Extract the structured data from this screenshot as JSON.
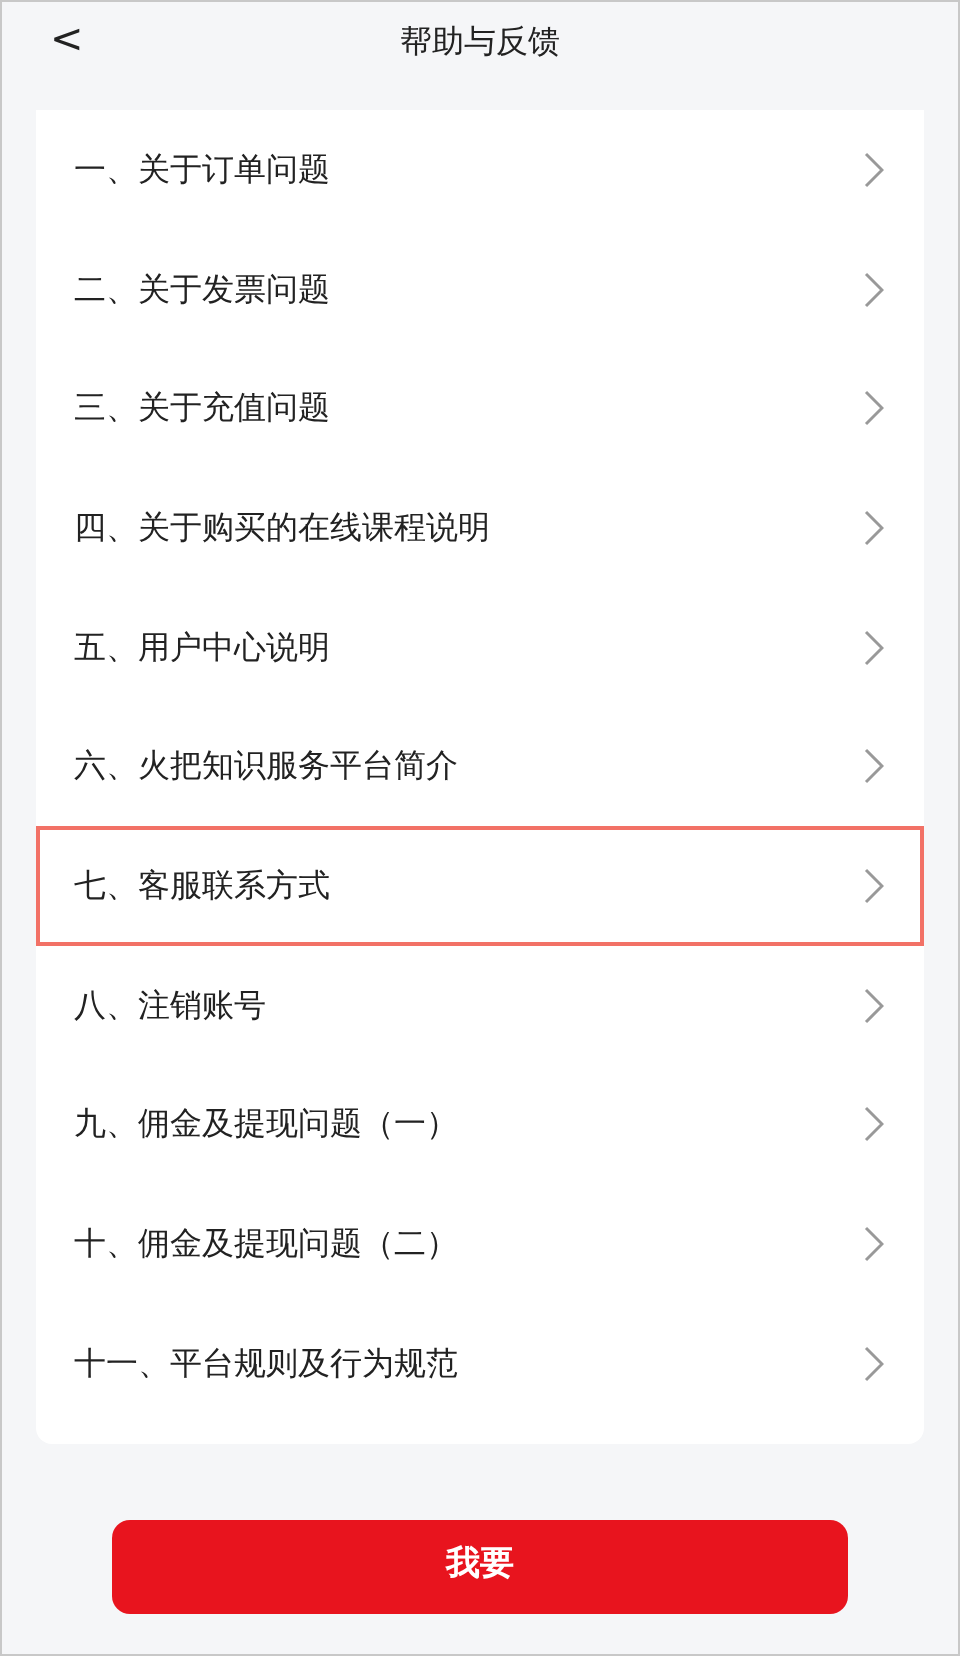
{
  "header": {
    "back": "<",
    "title": "帮助与反馈"
  },
  "items": [
    {
      "label": "一、关于订单问题",
      "selected": false
    },
    {
      "label": "二、关于发票问题",
      "selected": false
    },
    {
      "label": "三、关于充值问题",
      "selected": false
    },
    {
      "label": "四、关于购买的在线课程说明",
      "selected": false
    },
    {
      "label": "五、用户中心说明",
      "selected": false
    },
    {
      "label": "六、火把知识服务平台简介",
      "selected": false
    },
    {
      "label": "七、客服联系方式",
      "selected": true
    },
    {
      "label": "八、注销账号",
      "selected": false
    },
    {
      "label": "九、佣金及提现问题（一）",
      "selected": false
    },
    {
      "label": "十、佣金及提现问题（二）",
      "selected": false
    },
    {
      "label": "十一、平台规则及行为规范",
      "selected": false
    }
  ],
  "button": "我要"
}
